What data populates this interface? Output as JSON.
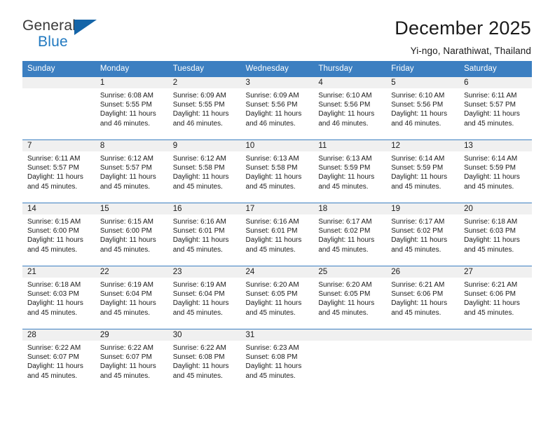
{
  "logo": {
    "word1": "General",
    "word2": "Blue",
    "triangle_color": "#1565a8",
    "blue_text_color": "#2179c0"
  },
  "header": {
    "title": "December 2025",
    "subtitle": "Yi-ngo, Narathiwat, Thailand"
  },
  "theme": {
    "header_bar_color": "#3c7fc1",
    "daynum_band_color": "#f0f0f0",
    "row_rule_color": "#3c7fc1"
  },
  "calendar": {
    "weekday_headers": [
      "Sunday",
      "Monday",
      "Tuesday",
      "Wednesday",
      "Thursday",
      "Friday",
      "Saturday"
    ],
    "labels": {
      "sunrise_prefix": "Sunrise:",
      "sunset_prefix": "Sunset:",
      "daylight_prefix": "Daylight:"
    },
    "weeks": [
      {
        "shaded": true,
        "days": [
          {
            "num": "",
            "sunrise": "",
            "sunset": "",
            "daylight_line1": "",
            "daylight_line2": ""
          },
          {
            "num": "1",
            "sunrise": "Sunrise: 6:08 AM",
            "sunset": "Sunset: 5:55 PM",
            "daylight_line1": "Daylight: 11 hours",
            "daylight_line2": "and 46 minutes."
          },
          {
            "num": "2",
            "sunrise": "Sunrise: 6:09 AM",
            "sunset": "Sunset: 5:55 PM",
            "daylight_line1": "Daylight: 11 hours",
            "daylight_line2": "and 46 minutes."
          },
          {
            "num": "3",
            "sunrise": "Sunrise: 6:09 AM",
            "sunset": "Sunset: 5:56 PM",
            "daylight_line1": "Daylight: 11 hours",
            "daylight_line2": "and 46 minutes."
          },
          {
            "num": "4",
            "sunrise": "Sunrise: 6:10 AM",
            "sunset": "Sunset: 5:56 PM",
            "daylight_line1": "Daylight: 11 hours",
            "daylight_line2": "and 46 minutes."
          },
          {
            "num": "5",
            "sunrise": "Sunrise: 6:10 AM",
            "sunset": "Sunset: 5:56 PM",
            "daylight_line1": "Daylight: 11 hours",
            "daylight_line2": "and 46 minutes."
          },
          {
            "num": "6",
            "sunrise": "Sunrise: 6:11 AM",
            "sunset": "Sunset: 5:57 PM",
            "daylight_line1": "Daylight: 11 hours",
            "daylight_line2": "and 45 minutes."
          }
        ]
      },
      {
        "shaded": true,
        "days": [
          {
            "num": "7",
            "sunrise": "Sunrise: 6:11 AM",
            "sunset": "Sunset: 5:57 PM",
            "daylight_line1": "Daylight: 11 hours",
            "daylight_line2": "and 45 minutes."
          },
          {
            "num": "8",
            "sunrise": "Sunrise: 6:12 AM",
            "sunset": "Sunset: 5:57 PM",
            "daylight_line1": "Daylight: 11 hours",
            "daylight_line2": "and 45 minutes."
          },
          {
            "num": "9",
            "sunrise": "Sunrise: 6:12 AM",
            "sunset": "Sunset: 5:58 PM",
            "daylight_line1": "Daylight: 11 hours",
            "daylight_line2": "and 45 minutes."
          },
          {
            "num": "10",
            "sunrise": "Sunrise: 6:13 AM",
            "sunset": "Sunset: 5:58 PM",
            "daylight_line1": "Daylight: 11 hours",
            "daylight_line2": "and 45 minutes."
          },
          {
            "num": "11",
            "sunrise": "Sunrise: 6:13 AM",
            "sunset": "Sunset: 5:59 PM",
            "daylight_line1": "Daylight: 11 hours",
            "daylight_line2": "and 45 minutes."
          },
          {
            "num": "12",
            "sunrise": "Sunrise: 6:14 AM",
            "sunset": "Sunset: 5:59 PM",
            "daylight_line1": "Daylight: 11 hours",
            "daylight_line2": "and 45 minutes."
          },
          {
            "num": "13",
            "sunrise": "Sunrise: 6:14 AM",
            "sunset": "Sunset: 5:59 PM",
            "daylight_line1": "Daylight: 11 hours",
            "daylight_line2": "and 45 minutes."
          }
        ]
      },
      {
        "shaded": true,
        "days": [
          {
            "num": "14",
            "sunrise": "Sunrise: 6:15 AM",
            "sunset": "Sunset: 6:00 PM",
            "daylight_line1": "Daylight: 11 hours",
            "daylight_line2": "and 45 minutes."
          },
          {
            "num": "15",
            "sunrise": "Sunrise: 6:15 AM",
            "sunset": "Sunset: 6:00 PM",
            "daylight_line1": "Daylight: 11 hours",
            "daylight_line2": "and 45 minutes."
          },
          {
            "num": "16",
            "sunrise": "Sunrise: 6:16 AM",
            "sunset": "Sunset: 6:01 PM",
            "daylight_line1": "Daylight: 11 hours",
            "daylight_line2": "and 45 minutes."
          },
          {
            "num": "17",
            "sunrise": "Sunrise: 6:16 AM",
            "sunset": "Sunset: 6:01 PM",
            "daylight_line1": "Daylight: 11 hours",
            "daylight_line2": "and 45 minutes."
          },
          {
            "num": "18",
            "sunrise": "Sunrise: 6:17 AM",
            "sunset": "Sunset: 6:02 PM",
            "daylight_line1": "Daylight: 11 hours",
            "daylight_line2": "and 45 minutes."
          },
          {
            "num": "19",
            "sunrise": "Sunrise: 6:17 AM",
            "sunset": "Sunset: 6:02 PM",
            "daylight_line1": "Daylight: 11 hours",
            "daylight_line2": "and 45 minutes."
          },
          {
            "num": "20",
            "sunrise": "Sunrise: 6:18 AM",
            "sunset": "Sunset: 6:03 PM",
            "daylight_line1": "Daylight: 11 hours",
            "daylight_line2": "and 45 minutes."
          }
        ]
      },
      {
        "shaded": true,
        "days": [
          {
            "num": "21",
            "sunrise": "Sunrise: 6:18 AM",
            "sunset": "Sunset: 6:03 PM",
            "daylight_line1": "Daylight: 11 hours",
            "daylight_line2": "and 45 minutes."
          },
          {
            "num": "22",
            "sunrise": "Sunrise: 6:19 AM",
            "sunset": "Sunset: 6:04 PM",
            "daylight_line1": "Daylight: 11 hours",
            "daylight_line2": "and 45 minutes."
          },
          {
            "num": "23",
            "sunrise": "Sunrise: 6:19 AM",
            "sunset": "Sunset: 6:04 PM",
            "daylight_line1": "Daylight: 11 hours",
            "daylight_line2": "and 45 minutes."
          },
          {
            "num": "24",
            "sunrise": "Sunrise: 6:20 AM",
            "sunset": "Sunset: 6:05 PM",
            "daylight_line1": "Daylight: 11 hours",
            "daylight_line2": "and 45 minutes."
          },
          {
            "num": "25",
            "sunrise": "Sunrise: 6:20 AM",
            "sunset": "Sunset: 6:05 PM",
            "daylight_line1": "Daylight: 11 hours",
            "daylight_line2": "and 45 minutes."
          },
          {
            "num": "26",
            "sunrise": "Sunrise: 6:21 AM",
            "sunset": "Sunset: 6:06 PM",
            "daylight_line1": "Daylight: 11 hours",
            "daylight_line2": "and 45 minutes."
          },
          {
            "num": "27",
            "sunrise": "Sunrise: 6:21 AM",
            "sunset": "Sunset: 6:06 PM",
            "daylight_line1": "Daylight: 11 hours",
            "daylight_line2": "and 45 minutes."
          }
        ]
      },
      {
        "shaded": true,
        "days": [
          {
            "num": "28",
            "sunrise": "Sunrise: 6:22 AM",
            "sunset": "Sunset: 6:07 PM",
            "daylight_line1": "Daylight: 11 hours",
            "daylight_line2": "and 45 minutes."
          },
          {
            "num": "29",
            "sunrise": "Sunrise: 6:22 AM",
            "sunset": "Sunset: 6:07 PM",
            "daylight_line1": "Daylight: 11 hours",
            "daylight_line2": "and 45 minutes."
          },
          {
            "num": "30",
            "sunrise": "Sunrise: 6:22 AM",
            "sunset": "Sunset: 6:08 PM",
            "daylight_line1": "Daylight: 11 hours",
            "daylight_line2": "and 45 minutes."
          },
          {
            "num": "31",
            "sunrise": "Sunrise: 6:23 AM",
            "sunset": "Sunset: 6:08 PM",
            "daylight_line1": "Daylight: 11 hours",
            "daylight_line2": "and 45 minutes."
          },
          {
            "num": "",
            "sunrise": "",
            "sunset": "",
            "daylight_line1": "",
            "daylight_line2": ""
          },
          {
            "num": "",
            "sunrise": "",
            "sunset": "",
            "daylight_line1": "",
            "daylight_line2": ""
          },
          {
            "num": "",
            "sunrise": "",
            "sunset": "",
            "daylight_line1": "",
            "daylight_line2": ""
          }
        ]
      }
    ]
  }
}
